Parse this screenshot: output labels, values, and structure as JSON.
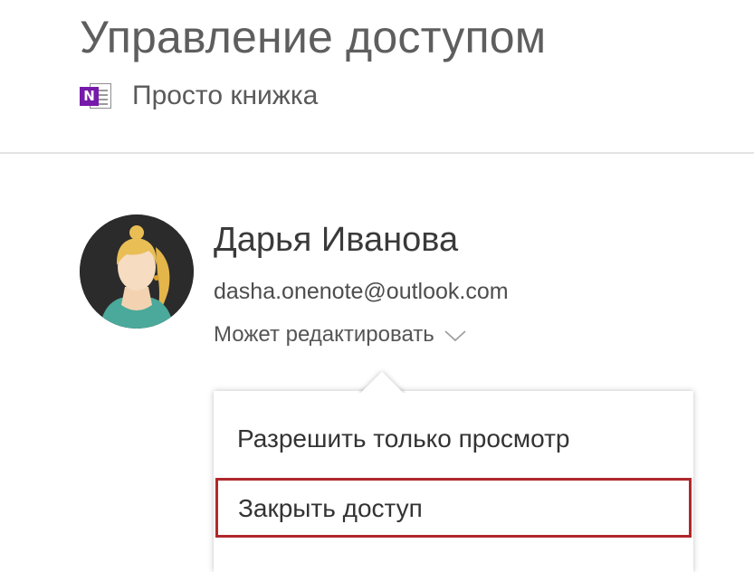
{
  "header": {
    "title": "Управление доступом",
    "notebook_icon": "onenote-icon",
    "notebook_icon_letter": "N",
    "notebook_name": "Просто книжка"
  },
  "user": {
    "avatar_icon": "avatar-illustration",
    "name": "Дарья Иванова",
    "email": "dasha.onenote@outlook.com",
    "permission": "Может редактировать",
    "permission_icon": "chevron-down-icon"
  },
  "permission_menu": {
    "items": [
      {
        "label": "Разрешить только просмотр"
      },
      {
        "label": "Закрыть доступ",
        "highlighted": true
      }
    ]
  },
  "colors": {
    "onenote_purple": "#7719aa",
    "highlight_border": "#b0282c",
    "avatar_background": "#2b2b2b"
  }
}
